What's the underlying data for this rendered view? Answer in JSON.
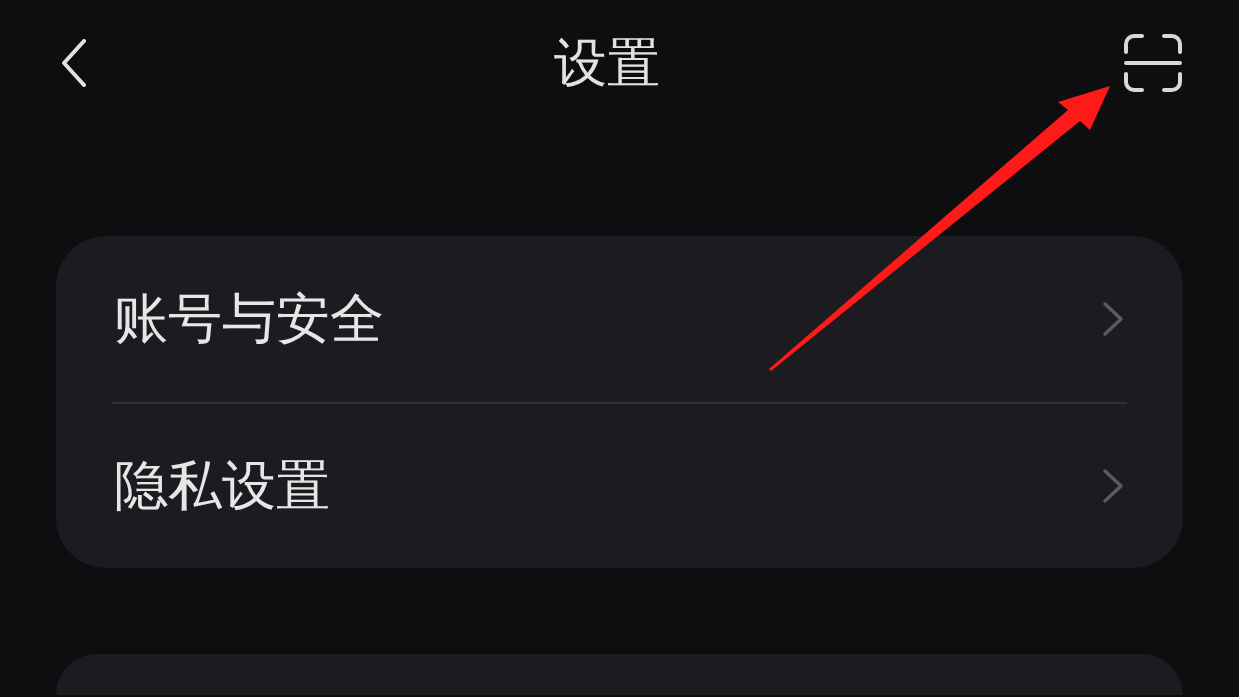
{
  "header": {
    "title": "设置"
  },
  "sections": [
    {
      "items": [
        {
          "label": "账号与安全"
        },
        {
          "label": "隐私设置"
        }
      ]
    }
  ]
}
